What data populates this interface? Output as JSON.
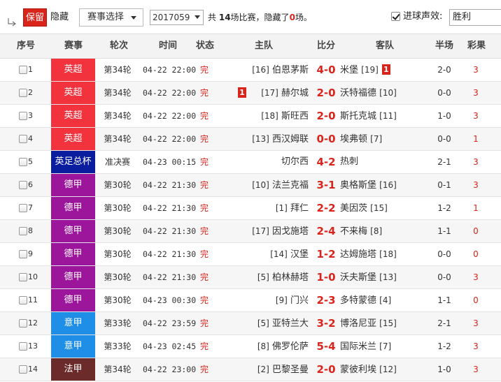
{
  "toolbar": {
    "keep_label": "保留",
    "hide_label": "隐藏",
    "event_select_label": "赛事选择",
    "issue_select_value": "2017059",
    "summary_prefix": "共",
    "total_count": "14",
    "summary_mid": "场比赛，隐藏了",
    "hidden_count": "0",
    "summary_suffix": "场。",
    "goal_sound_label": "进球声效:",
    "goal_sound_checked": true,
    "goal_sound_value": "胜利"
  },
  "columns": {
    "index": "序号",
    "event": "赛事",
    "round": "轮次",
    "time": "时间",
    "status": "状态",
    "home": "主队",
    "score": "比分",
    "away": "客队",
    "half": "半场",
    "lottery": "彩果"
  },
  "colors": {
    "epl": "#f2333e",
    "fa_cup": "#0a1d9e",
    "bundesliga": "#9b169b",
    "serie_a": "#1e8ee6",
    "ligue1": "#6b2b2b",
    "accent_red": "#d9241c"
  },
  "matches": [
    {
      "index": "1",
      "league": "英超",
      "league_color": "#f2333e",
      "round": "第34轮",
      "time": "04-22 22:00",
      "status": "完",
      "home_rank": "[16]",
      "home": "伯恩茅斯",
      "score": "4-0",
      "away": "米堡",
      "away_rank": "[19]",
      "home_red": "",
      "away_red": "1",
      "half": "2-0",
      "lottery": "3"
    },
    {
      "index": "2",
      "league": "英超",
      "league_color": "#f2333e",
      "round": "第34轮",
      "time": "04-22 22:00",
      "status": "完",
      "home_rank": "[17]",
      "home": "赫尔城",
      "score": "2-0",
      "away": "沃特福德",
      "away_rank": "[10]",
      "home_red": "1",
      "away_red": "",
      "half": "0-0",
      "lottery": "3"
    },
    {
      "index": "3",
      "league": "英超",
      "league_color": "#f2333e",
      "round": "第34轮",
      "time": "04-22 22:00",
      "status": "完",
      "home_rank": "[18]",
      "home": "斯旺西",
      "score": "2-0",
      "away": "斯托克城",
      "away_rank": "[11]",
      "home_red": "",
      "away_red": "",
      "half": "1-0",
      "lottery": "3"
    },
    {
      "index": "4",
      "league": "英超",
      "league_color": "#f2333e",
      "round": "第34轮",
      "time": "04-22 22:00",
      "status": "完",
      "home_rank": "[13]",
      "home": "西汉姆联",
      "score": "0-0",
      "away": "埃弗顿",
      "away_rank": "[7]",
      "home_red": "",
      "away_red": "",
      "half": "0-0",
      "lottery": "1"
    },
    {
      "index": "5",
      "league": "英足总杯",
      "league_color": "#0a1d9e",
      "round": "准决赛",
      "time": "04-23 00:15",
      "status": "完",
      "home_rank": "",
      "home": "切尔西",
      "score": "4-2",
      "away": "热刺",
      "away_rank": "",
      "home_red": "",
      "away_red": "",
      "half": "2-1",
      "lottery": "3"
    },
    {
      "index": "6",
      "league": "德甲",
      "league_color": "#9b169b",
      "round": "第30轮",
      "time": "04-22 21:30",
      "status": "完",
      "home_rank": "[10]",
      "home": "法兰克福",
      "score": "3-1",
      "away": "奥格斯堡",
      "away_rank": "[16]",
      "home_red": "",
      "away_red": "",
      "half": "0-1",
      "lottery": "3"
    },
    {
      "index": "7",
      "league": "德甲",
      "league_color": "#9b169b",
      "round": "第30轮",
      "time": "04-22 21:30",
      "status": "完",
      "home_rank": "[1]",
      "home": "拜仁",
      "score": "2-2",
      "away": "美因茨",
      "away_rank": "[15]",
      "home_red": "",
      "away_red": "",
      "half": "1-2",
      "lottery": "1"
    },
    {
      "index": "8",
      "league": "德甲",
      "league_color": "#9b169b",
      "round": "第30轮",
      "time": "04-22 21:30",
      "status": "完",
      "home_rank": "[17]",
      "home": "因戈施塔",
      "score": "2-4",
      "away": "不来梅",
      "away_rank": "[8]",
      "home_red": "",
      "away_red": "",
      "half": "1-1",
      "lottery": "0"
    },
    {
      "index": "9",
      "league": "德甲",
      "league_color": "#9b169b",
      "round": "第30轮",
      "time": "04-22 21:30",
      "status": "完",
      "home_rank": "[14]",
      "home": "汉堡",
      "score": "1-2",
      "away": "达姆施塔",
      "away_rank": "[18]",
      "home_red": "",
      "away_red": "",
      "half": "0-0",
      "lottery": "0"
    },
    {
      "index": "10",
      "league": "德甲",
      "league_color": "#9b169b",
      "round": "第30轮",
      "time": "04-22 21:30",
      "status": "完",
      "home_rank": "[5]",
      "home": "柏林赫塔",
      "score": "1-0",
      "away": "沃夫斯堡",
      "away_rank": "[13]",
      "home_red": "",
      "away_red": "",
      "half": "0-0",
      "lottery": "3"
    },
    {
      "index": "11",
      "league": "德甲",
      "league_color": "#9b169b",
      "round": "第30轮",
      "time": "04-23 00:30",
      "status": "完",
      "home_rank": "[9]",
      "home": "门兴",
      "score": "2-3",
      "away": "多特蒙德",
      "away_rank": "[4]",
      "home_red": "",
      "away_red": "",
      "half": "1-1",
      "lottery": "0"
    },
    {
      "index": "12",
      "league": "意甲",
      "league_color": "#1e8ee6",
      "round": "第33轮",
      "time": "04-22 23:59",
      "status": "完",
      "home_rank": "[5]",
      "home": "亚特兰大",
      "score": "3-2",
      "away": "博洛尼亚",
      "away_rank": "[15]",
      "home_red": "",
      "away_red": "",
      "half": "2-1",
      "lottery": "3"
    },
    {
      "index": "13",
      "league": "意甲",
      "league_color": "#1e8ee6",
      "round": "第33轮",
      "time": "04-23 02:45",
      "status": "完",
      "home_rank": "[8]",
      "home": "佛罗伦萨",
      "score": "5-4",
      "away": "国际米兰",
      "away_rank": "[7]",
      "home_red": "",
      "away_red": "",
      "half": "1-2",
      "lottery": "3"
    },
    {
      "index": "14",
      "league": "法甲",
      "league_color": "#6b2b2b",
      "round": "第34轮",
      "time": "04-22 23:00",
      "status": "完",
      "home_rank": "[2]",
      "home": "巴黎圣曼",
      "score": "2-0",
      "away": "蒙彼利埃",
      "away_rank": "[12]",
      "home_red": "",
      "away_red": "",
      "half": "1-0",
      "lottery": "3"
    }
  ]
}
